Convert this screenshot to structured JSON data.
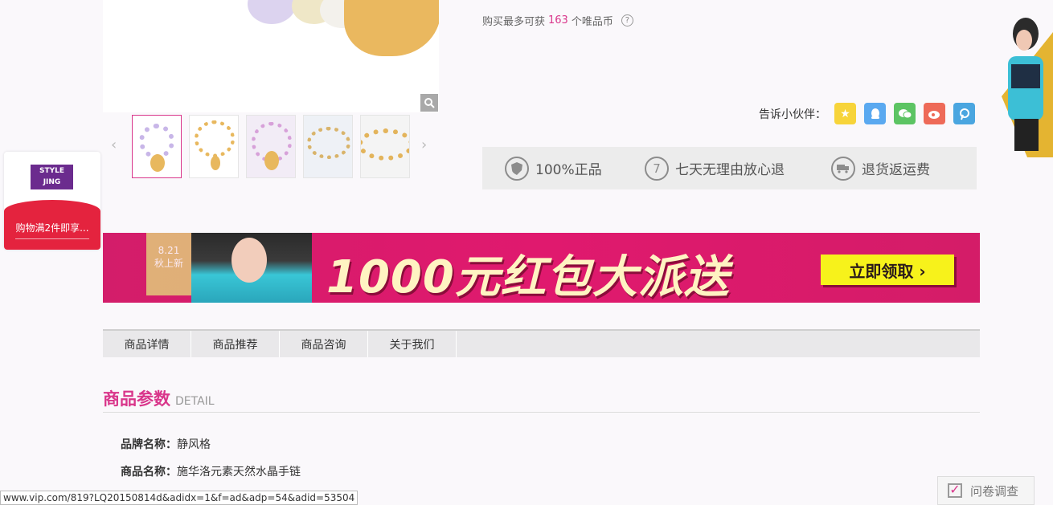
{
  "coins": {
    "prefix": "购买最多可获",
    "count": "163",
    "suffix": "个唯品币",
    "help": "?"
  },
  "share": {
    "label": "告诉小伙伴：",
    "icons": [
      "qzone-icon",
      "qq-icon",
      "wechat-icon",
      "weibo-icon",
      "pinterest-icon"
    ]
  },
  "guarantee": {
    "items": [
      {
        "icon": "shield-icon",
        "label": "100%正品"
      },
      {
        "icon": "seven-day-icon",
        "label": "七天无理由放心退"
      },
      {
        "icon": "truck-icon",
        "label": "退货返运费"
      }
    ]
  },
  "float_ad": {
    "logo_line1": "STYLE",
    "logo_line2": "JING",
    "text": "购物满2件即享..."
  },
  "banner": {
    "date": "8.21",
    "tag": "秋上新",
    "headline": "1000元红包大派送",
    "cta": "立即领取 ›"
  },
  "tabs": [
    "商品详情",
    "商品推荐",
    "商品咨询",
    "关于我们"
  ],
  "detail": {
    "title_cn": "商品参数",
    "title_en": "DETAIL",
    "params": [
      {
        "label": "品牌名称：",
        "value": "静风格"
      },
      {
        "label": "商品名称：",
        "value": "施华洛元素天然水晶手链"
      }
    ]
  },
  "status_url": "www.vip.com/819?LQ20150814d&adidx=1&f=ad&adp=54&adid=53504",
  "survey": {
    "label": "问卷调查"
  },
  "colors": {
    "accent": "#d9368b",
    "banner": "#e0196e",
    "cta": "#f7f21b",
    "float_red": "#e4233e"
  }
}
